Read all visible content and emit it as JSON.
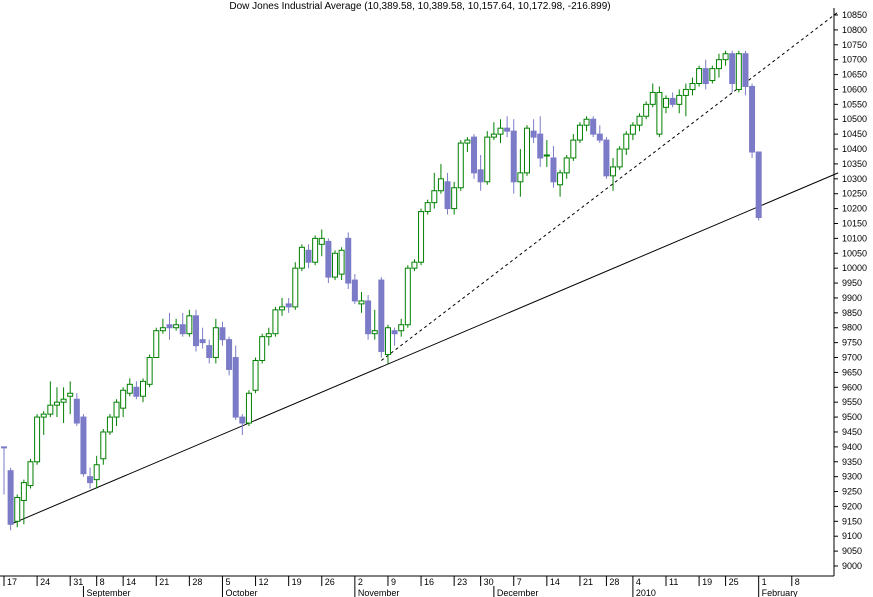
{
  "chart_data": {
    "type": "candlestick",
    "title": "Dow Jones Industrial Average (10,389.58, 10,389.58, 10,157.64, 10,172.98, -216.899)",
    "colors": {
      "up": "#008000",
      "down": "#7b7bc8",
      "trendline": "#000000",
      "axis": "#000000"
    },
    "ylim": [
      8950,
      10900
    ],
    "y_ticks": [
      9000,
      9050,
      9100,
      9150,
      9200,
      9250,
      9300,
      9350,
      9400,
      9450,
      9500,
      9550,
      9600,
      9650,
      9700,
      9750,
      9800,
      9850,
      9900,
      9950,
      10000,
      10050,
      10100,
      10150,
      10200,
      10250,
      10300,
      10350,
      10400,
      10450,
      10500,
      10550,
      10600,
      10650,
      10700,
      10750,
      10800,
      10850
    ],
    "x_day_ticks": [
      {
        "label": "17",
        "i": 0
      },
      {
        "label": "24",
        "i": 5
      },
      {
        "label": "31",
        "i": 10
      },
      {
        "label": "8",
        "i": 14
      },
      {
        "label": "14",
        "i": 18
      },
      {
        "label": "21",
        "i": 23
      },
      {
        "label": "28",
        "i": 28
      },
      {
        "label": "5",
        "i": 33
      },
      {
        "label": "12",
        "i": 38
      },
      {
        "label": "19",
        "i": 43
      },
      {
        "label": "26",
        "i": 48
      },
      {
        "label": "2",
        "i": 53
      },
      {
        "label": "9",
        "i": 58
      },
      {
        "label": "16",
        "i": 63
      },
      {
        "label": "23",
        "i": 68
      },
      {
        "label": "30",
        "i": 72
      },
      {
        "label": "7",
        "i": 77
      },
      {
        "label": "14",
        "i": 82
      },
      {
        "label": "21",
        "i": 87
      },
      {
        "label": "28",
        "i": 91
      },
      {
        "label": "4",
        "i": 95
      },
      {
        "label": "11",
        "i": 100
      },
      {
        "label": "19",
        "i": 105
      },
      {
        "label": "25",
        "i": 109
      },
      {
        "label": "1",
        "i": 114
      },
      {
        "label": "8",
        "i": 119
      }
    ],
    "x_month_labels": [
      {
        "label": "September",
        "i": 12
      },
      {
        "label": "October",
        "i": 33
      },
      {
        "label": "November",
        "i": 53
      },
      {
        "label": "December",
        "i": 74
      },
      {
        "label": "2010",
        "i": 95
      },
      {
        "label": "February",
        "i": 114
      }
    ],
    "candles": [
      {
        "o": 9400,
        "h": 9400,
        "l": 9240,
        "c": 9400,
        "up": false
      },
      {
        "o": 9320,
        "h": 9330,
        "l": 9120,
        "c": 9140,
        "up": false
      },
      {
        "o": 9150,
        "h": 9240,
        "l": 9130,
        "c": 9230,
        "up": true
      },
      {
        "o": 9220,
        "h": 9290,
        "l": 9140,
        "c": 9280,
        "up": true
      },
      {
        "o": 9270,
        "h": 9360,
        "l": 9260,
        "c": 9350,
        "up": true
      },
      {
        "o": 9350,
        "h": 9510,
        "l": 9340,
        "c": 9500,
        "up": true
      },
      {
        "o": 9500,
        "h": 9520,
        "l": 9440,
        "c": 9510,
        "up": true
      },
      {
        "o": 9510,
        "h": 9620,
        "l": 9500,
        "c": 9540,
        "up": true
      },
      {
        "o": 9540,
        "h": 9600,
        "l": 9500,
        "c": 9550,
        "up": true
      },
      {
        "o": 9550,
        "h": 9600,
        "l": 9480,
        "c": 9560,
        "up": true
      },
      {
        "o": 9570,
        "h": 9620,
        "l": 9510,
        "c": 9580,
        "up": true
      },
      {
        "o": 9560,
        "h": 9580,
        "l": 9470,
        "c": 9480,
        "up": false
      },
      {
        "o": 9500,
        "h": 9510,
        "l": 9300,
        "c": 9310,
        "up": false
      },
      {
        "o": 9300,
        "h": 9330,
        "l": 9260,
        "c": 9280,
        "up": false
      },
      {
        "o": 9290,
        "h": 9370,
        "l": 9260,
        "c": 9340,
        "up": true
      },
      {
        "o": 9360,
        "h": 9460,
        "l": 9340,
        "c": 9450,
        "up": true
      },
      {
        "o": 9450,
        "h": 9510,
        "l": 9440,
        "c": 9500,
        "up": true
      },
      {
        "o": 9500,
        "h": 9560,
        "l": 9470,
        "c": 9550,
        "up": true
      },
      {
        "o": 9530,
        "h": 9600,
        "l": 9500,
        "c": 9590,
        "up": true
      },
      {
        "o": 9580,
        "h": 9630,
        "l": 9570,
        "c": 9610,
        "up": true
      },
      {
        "o": 9600,
        "h": 9620,
        "l": 9560,
        "c": 9570,
        "up": false
      },
      {
        "o": 9570,
        "h": 9630,
        "l": 9550,
        "c": 9620,
        "up": true
      },
      {
        "o": 9610,
        "h": 9710,
        "l": 9600,
        "c": 9700,
        "up": true
      },
      {
        "o": 9700,
        "h": 9800,
        "l": 9700,
        "c": 9790,
        "up": true
      },
      {
        "o": 9790,
        "h": 9830,
        "l": 9780,
        "c": 9800,
        "up": true
      },
      {
        "o": 9800,
        "h": 9850,
        "l": 9760,
        "c": 9810,
        "up": false
      },
      {
        "o": 9810,
        "h": 9830,
        "l": 9790,
        "c": 9800,
        "up": true
      },
      {
        "o": 9810,
        "h": 9850,
        "l": 9770,
        "c": 9780,
        "up": false
      },
      {
        "o": 9780,
        "h": 9860,
        "l": 9770,
        "c": 9840,
        "up": true
      },
      {
        "o": 9840,
        "h": 9860,
        "l": 9720,
        "c": 9740,
        "up": false
      },
      {
        "o": 9760,
        "h": 9800,
        "l": 9730,
        "c": 9750,
        "up": false
      },
      {
        "o": 9740,
        "h": 9760,
        "l": 9680,
        "c": 9700,
        "up": false
      },
      {
        "o": 9700,
        "h": 9830,
        "l": 9680,
        "c": 9800,
        "up": true
      },
      {
        "o": 9800,
        "h": 9820,
        "l": 9740,
        "c": 9760,
        "up": false
      },
      {
        "o": 9760,
        "h": 9770,
        "l": 9640,
        "c": 9660,
        "up": false
      },
      {
        "o": 9700,
        "h": 9740,
        "l": 9490,
        "c": 9500,
        "up": false
      },
      {
        "o": 9500,
        "h": 9510,
        "l": 9440,
        "c": 9480,
        "up": false
      },
      {
        "o": 9480,
        "h": 9590,
        "l": 9470,
        "c": 9580,
        "up": true
      },
      {
        "o": 9590,
        "h": 9700,
        "l": 9580,
        "c": 9690,
        "up": true
      },
      {
        "o": 9690,
        "h": 9780,
        "l": 9680,
        "c": 9770,
        "up": true
      },
      {
        "o": 9770,
        "h": 9800,
        "l": 9740,
        "c": 9780,
        "up": true
      },
      {
        "o": 9780,
        "h": 9870,
        "l": 9770,
        "c": 9860,
        "up": true
      },
      {
        "o": 9860,
        "h": 9900,
        "l": 9840,
        "c": 9870,
        "up": true
      },
      {
        "o": 9880,
        "h": 9900,
        "l": 9850,
        "c": 9870,
        "up": false
      },
      {
        "o": 9870,
        "h": 10020,
        "l": 9860,
        "c": 10000,
        "up": true
      },
      {
        "o": 10000,
        "h": 10080,
        "l": 9990,
        "c": 10070,
        "up": true
      },
      {
        "o": 10060,
        "h": 10080,
        "l": 10000,
        "c": 10020,
        "up": false
      },
      {
        "o": 10020,
        "h": 10110,
        "l": 10010,
        "c": 10100,
        "up": true
      },
      {
        "o": 10100,
        "h": 10130,
        "l": 10040,
        "c": 10080,
        "up": true
      },
      {
        "o": 10090,
        "h": 10100,
        "l": 9950,
        "c": 9970,
        "up": false
      },
      {
        "o": 9970,
        "h": 10060,
        "l": 9960,
        "c": 10050,
        "up": true
      },
      {
        "o": 10060,
        "h": 10070,
        "l": 9960,
        "c": 9980,
        "up": true
      },
      {
        "o": 10100,
        "h": 10120,
        "l": 9930,
        "c": 9950,
        "up": false
      },
      {
        "o": 9960,
        "h": 9980,
        "l": 9880,
        "c": 9890,
        "up": false
      },
      {
        "o": 9890,
        "h": 9920,
        "l": 9850,
        "c": 9880,
        "up": true
      },
      {
        "o": 9890,
        "h": 9910,
        "l": 9760,
        "c": 9780,
        "up": false
      },
      {
        "o": 9780,
        "h": 9860,
        "l": 9760,
        "c": 9790,
        "up": true
      },
      {
        "o": 9960,
        "h": 9970,
        "l": 9700,
        "c": 9720,
        "up": false
      },
      {
        "o": 9710,
        "h": 9810,
        "l": 9680,
        "c": 9800,
        "up": true
      },
      {
        "o": 9790,
        "h": 9800,
        "l": 9740,
        "c": 9780,
        "up": false
      },
      {
        "o": 9790,
        "h": 9830,
        "l": 9770,
        "c": 9810,
        "up": true
      },
      {
        "o": 9810,
        "h": 10010,
        "l": 9800,
        "c": 10000,
        "up": true
      },
      {
        "o": 10000,
        "h": 10030,
        "l": 9990,
        "c": 10020,
        "up": true
      },
      {
        "o": 10020,
        "h": 10200,
        "l": 10010,
        "c": 10190,
        "up": true
      },
      {
        "o": 10190,
        "h": 10230,
        "l": 10180,
        "c": 10220,
        "up": true
      },
      {
        "o": 10220,
        "h": 10320,
        "l": 10200,
        "c": 10260,
        "up": true
      },
      {
        "o": 10260,
        "h": 10350,
        "l": 10250,
        "c": 10300,
        "up": true
      },
      {
        "o": 10290,
        "h": 10320,
        "l": 10180,
        "c": 10200,
        "up": false
      },
      {
        "o": 10200,
        "h": 10290,
        "l": 10180,
        "c": 10270,
        "up": true
      },
      {
        "o": 10270,
        "h": 10430,
        "l": 10260,
        "c": 10420,
        "up": true
      },
      {
        "o": 10420,
        "h": 10440,
        "l": 10390,
        "c": 10430,
        "up": true
      },
      {
        "o": 10440,
        "h": 10450,
        "l": 10300,
        "c": 10320,
        "up": false
      },
      {
        "o": 10330,
        "h": 10380,
        "l": 10260,
        "c": 10290,
        "up": false
      },
      {
        "o": 10290,
        "h": 10460,
        "l": 10280,
        "c": 10440,
        "up": true
      },
      {
        "o": 10440,
        "h": 10490,
        "l": 10430,
        "c": 10450,
        "up": true
      },
      {
        "o": 10450,
        "h": 10500,
        "l": 10420,
        "c": 10470,
        "up": true
      },
      {
        "o": 10470,
        "h": 10510,
        "l": 10440,
        "c": 10460,
        "up": false
      },
      {
        "o": 10460,
        "h": 10500,
        "l": 10250,
        "c": 10290,
        "up": false
      },
      {
        "o": 10290,
        "h": 10400,
        "l": 10240,
        "c": 10320,
        "up": true
      },
      {
        "o": 10320,
        "h": 10480,
        "l": 10310,
        "c": 10470,
        "up": true
      },
      {
        "o": 10460,
        "h": 10500,
        "l": 10420,
        "c": 10440,
        "up": false
      },
      {
        "o": 10450,
        "h": 10510,
        "l": 10340,
        "c": 10370,
        "up": false
      },
      {
        "o": 10380,
        "h": 10430,
        "l": 10340,
        "c": 10380,
        "up": true
      },
      {
        "o": 10370,
        "h": 10410,
        "l": 10270,
        "c": 10290,
        "up": false
      },
      {
        "o": 10280,
        "h": 10330,
        "l": 10240,
        "c": 10320,
        "up": true
      },
      {
        "o": 10320,
        "h": 10380,
        "l": 10300,
        "c": 10370,
        "up": true
      },
      {
        "o": 10370,
        "h": 10450,
        "l": 10360,
        "c": 10430,
        "up": true
      },
      {
        "o": 10430,
        "h": 10490,
        "l": 10420,
        "c": 10480,
        "up": true
      },
      {
        "o": 10480,
        "h": 10510,
        "l": 10460,
        "c": 10500,
        "up": true
      },
      {
        "o": 10500,
        "h": 10510,
        "l": 10440,
        "c": 10450,
        "up": false
      },
      {
        "o": 10450,
        "h": 10480,
        "l": 10420,
        "c": 10430,
        "up": false
      },
      {
        "o": 10430,
        "h": 10440,
        "l": 10300,
        "c": 10310,
        "up": false
      },
      {
        "o": 10310,
        "h": 10370,
        "l": 10260,
        "c": 10340,
        "up": true
      },
      {
        "o": 10340,
        "h": 10410,
        "l": 10330,
        "c": 10400,
        "up": true
      },
      {
        "o": 10400,
        "h": 10460,
        "l": 10380,
        "c": 10450,
        "up": true
      },
      {
        "o": 10450,
        "h": 10490,
        "l": 10430,
        "c": 10480,
        "up": true
      },
      {
        "o": 10480,
        "h": 10520,
        "l": 10460,
        "c": 10510,
        "up": true
      },
      {
        "o": 10510,
        "h": 10560,
        "l": 10500,
        "c": 10550,
        "up": true
      },
      {
        "o": 10550,
        "h": 10620,
        "l": 10540,
        "c": 10590,
        "up": true
      },
      {
        "o": 10590,
        "h": 10610,
        "l": 10440,
        "c": 10450,
        "up": true
      },
      {
        "o": 10540,
        "h": 10580,
        "l": 10520,
        "c": 10570,
        "up": true
      },
      {
        "o": 10570,
        "h": 10590,
        "l": 10540,
        "c": 10550,
        "up": false
      },
      {
        "o": 10550,
        "h": 10600,
        "l": 10520,
        "c": 10580,
        "up": true
      },
      {
        "o": 10580,
        "h": 10620,
        "l": 10510,
        "c": 10600,
        "up": true
      },
      {
        "o": 10600,
        "h": 10640,
        "l": 10580,
        "c": 10620,
        "up": true
      },
      {
        "o": 10620,
        "h": 10680,
        "l": 10610,
        "c": 10670,
        "up": true
      },
      {
        "o": 10670,
        "h": 10700,
        "l": 10600,
        "c": 10620,
        "up": false
      },
      {
        "o": 10630,
        "h": 10680,
        "l": 10620,
        "c": 10670,
        "up": true
      },
      {
        "o": 10670,
        "h": 10720,
        "l": 10640,
        "c": 10700,
        "up": true
      },
      {
        "o": 10700,
        "h": 10730,
        "l": 10680,
        "c": 10720,
        "up": true
      },
      {
        "o": 10720,
        "h": 10730,
        "l": 10590,
        "c": 10620,
        "up": false
      },
      {
        "o": 10600,
        "h": 10730,
        "l": 10590,
        "c": 10720,
        "up": true
      },
      {
        "o": 10720,
        "h": 10730,
        "l": 10580,
        "c": 10610,
        "up": false
      },
      {
        "o": 10610,
        "h": 10620,
        "l": 10370,
        "c": 10390,
        "up": false
      },
      {
        "o": 10390,
        "h": 10390,
        "l": 10160,
        "c": 10170,
        "up": false
      }
    ],
    "trendlines": [
      {
        "style": "solid",
        "x0": 1,
        "y0": 9140,
        "x1": 126,
        "y1": 10320
      },
      {
        "style": "dashed",
        "x0": 57,
        "y0": 9690,
        "x1": 126,
        "y1": 10860
      }
    ]
  }
}
